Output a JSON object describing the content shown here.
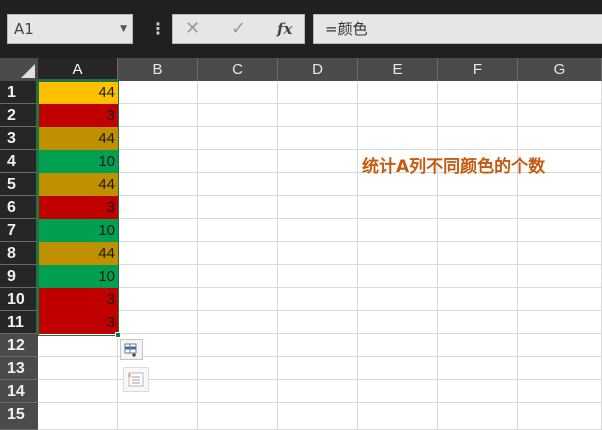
{
  "formula_bar": {
    "name_box": "A1",
    "cancel_icon": "✕",
    "enter_icon": "✓",
    "fx_label": "fx",
    "formula": "=颜色"
  },
  "columns": [
    "A",
    "B",
    "C",
    "D",
    "E",
    "F",
    "G"
  ],
  "rows": [
    {
      "num": "1",
      "value": "44",
      "color": "#ffc000"
    },
    {
      "num": "2",
      "value": "3",
      "color": "#c00000"
    },
    {
      "num": "3",
      "value": "44",
      "color": "#bf9000"
    },
    {
      "num": "4",
      "value": "10",
      "color": "#00a050"
    },
    {
      "num": "5",
      "value": "44",
      "color": "#bf9000"
    },
    {
      "num": "6",
      "value": "3",
      "color": "#c00000"
    },
    {
      "num": "7",
      "value": "10",
      "color": "#00a050"
    },
    {
      "num": "8",
      "value": "44",
      "color": "#bf9000"
    },
    {
      "num": "9",
      "value": "10",
      "color": "#00a050"
    },
    {
      "num": "10",
      "value": "3",
      "color": "#c00000"
    },
    {
      "num": "11",
      "value": "3",
      "color": "#c00000"
    },
    {
      "num": "12",
      "value": "",
      "color": ""
    },
    {
      "num": "13",
      "value": "",
      "color": ""
    },
    {
      "num": "14",
      "value": "",
      "color": ""
    },
    {
      "num": "15",
      "value": "",
      "color": ""
    }
  ],
  "annotation": {
    "text": "统计A列不同颜色的个数",
    "color": "#c55a11"
  },
  "icons": {
    "quick_analysis": "quick-analysis-icon",
    "paste_options": "paste-options-icon"
  }
}
